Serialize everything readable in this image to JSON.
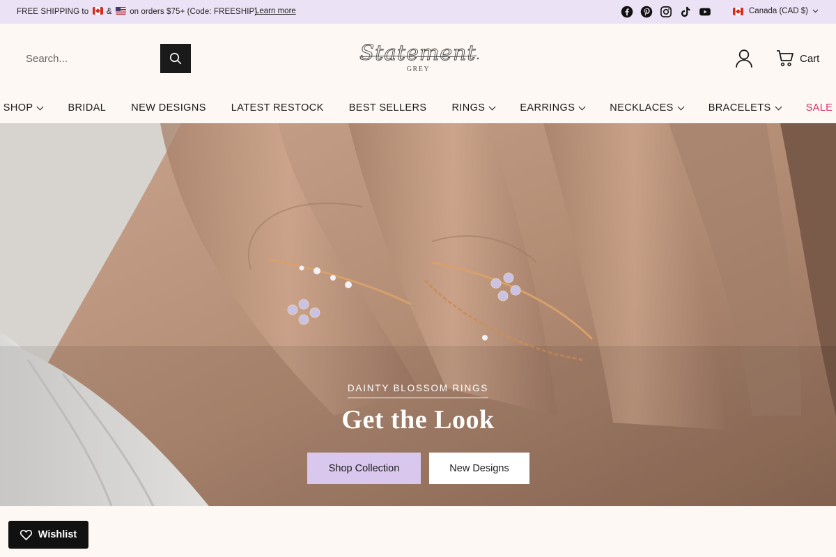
{
  "announcement": {
    "text_part1": "FREE SHIPPING to",
    "text_part2": "&",
    "text_part3": "on orders $75+ (Code: FREESHIP)",
    "learn_more": "Learn more"
  },
  "socials": [
    "facebook-icon",
    "pinterest-icon",
    "instagram-icon",
    "tiktok-icon",
    "youtube-icon"
  ],
  "region": {
    "label": "Canada (CAD $)"
  },
  "search": {
    "placeholder": "Search..."
  },
  "logo": {
    "script_text": "Statement",
    "sub_text": "GREY"
  },
  "cart": {
    "label": "Cart"
  },
  "nav": {
    "items": [
      {
        "label": "SHOP",
        "dropdown": true
      },
      {
        "label": "BRIDAL",
        "dropdown": false
      },
      {
        "label": "NEW DESIGNS",
        "dropdown": false
      },
      {
        "label": "LATEST RESTOCK",
        "dropdown": false
      },
      {
        "label": "BEST SELLERS",
        "dropdown": false
      },
      {
        "label": "RINGS",
        "dropdown": true
      },
      {
        "label": "EARRINGS",
        "dropdown": true
      },
      {
        "label": "NECKLACES",
        "dropdown": true
      },
      {
        "label": "BRACELETS",
        "dropdown": true
      },
      {
        "label": "SALE",
        "dropdown": false
      }
    ]
  },
  "hero": {
    "eyebrow": "DAINTY BLOSSOM RINGS",
    "title": "Get the Look",
    "primary_button": "Shop Collection",
    "secondary_button": "New Designs"
  },
  "wishlist": {
    "label": "Wishlist"
  },
  "colors": {
    "announcement_bg": "#ebe3f5",
    "primary_button": "#d9c7ee",
    "sale_accent": "#d92f68",
    "page_bg": "#fdf8f4"
  }
}
